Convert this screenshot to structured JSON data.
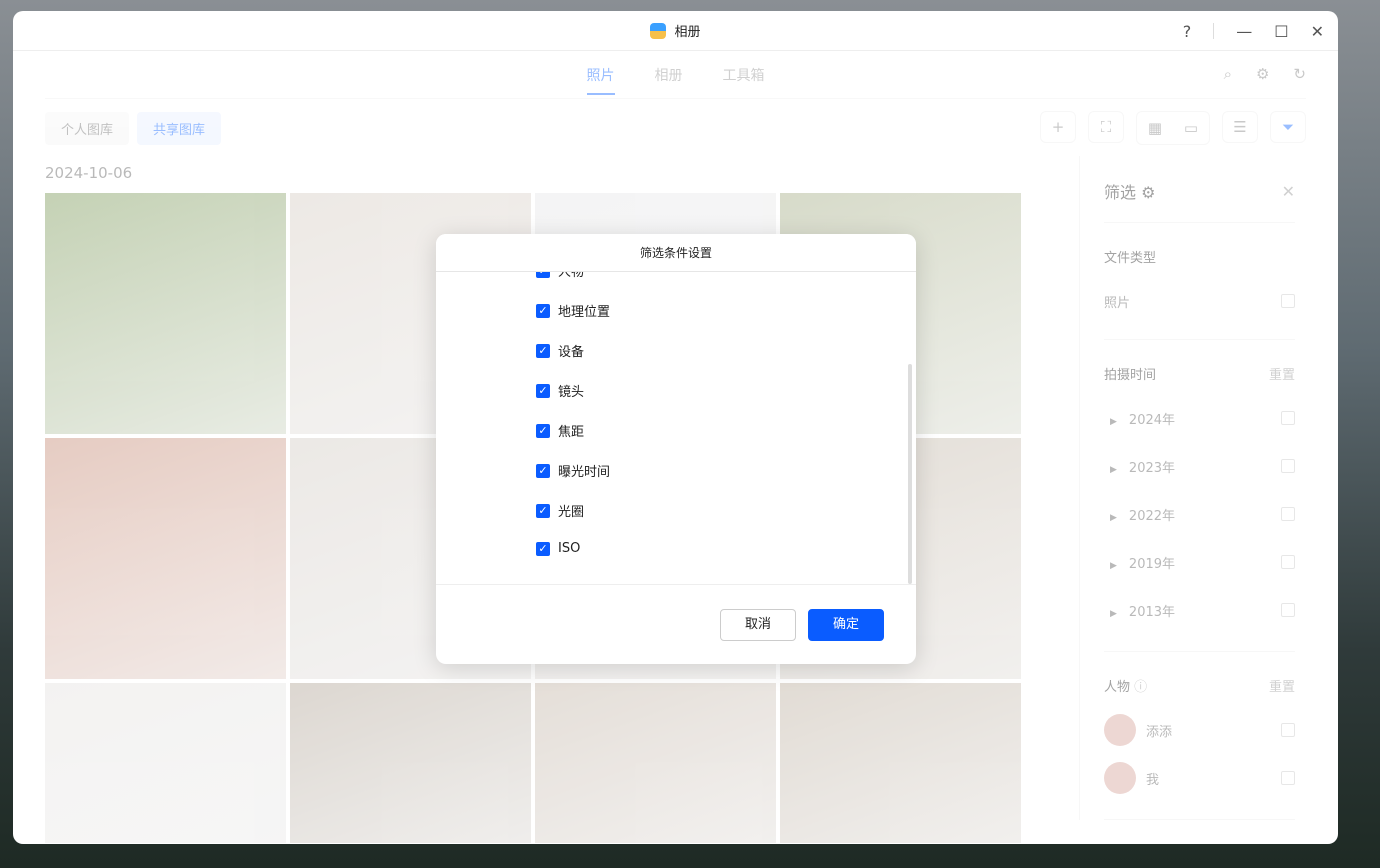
{
  "window": {
    "title": "相册",
    "help": "?",
    "minimize": "—",
    "maximize": "☐",
    "close": "✕"
  },
  "tabs": [
    {
      "label": "照片"
    },
    {
      "label": "相册"
    },
    {
      "label": "工具箱"
    }
  ],
  "library": {
    "personal": "个人图库",
    "shared": "共享图库"
  },
  "date": "2024-10-06",
  "photo_colors": [
    "#7d9a5a",
    "#d8cfc6",
    "#e8e8ea",
    "#a8b08a",
    "#c98f7a",
    "#d6cfc8",
    "#d8d0c8",
    "#c4b8a8",
    "#e6e4e2",
    "#b4a89a",
    "#c6b8aa",
    "#bfb2a2"
  ],
  "sidebar": {
    "title": "筛选",
    "file_type": {
      "heading": "文件类型",
      "items": [
        "照片"
      ]
    },
    "time": {
      "heading": "拍摄时间",
      "reset": "重置",
      "years": [
        "2024年",
        "2023年",
        "2022年",
        "2019年",
        "2013年"
      ]
    },
    "people": {
      "heading": "人物",
      "reset": "重置",
      "persons": [
        "添添",
        "我"
      ]
    }
  },
  "dialog": {
    "title": "筛选条件设置",
    "items": [
      "人物",
      "地理位置",
      "设备",
      "镜头",
      "焦距",
      "曝光时间",
      "光圈",
      "ISO"
    ],
    "cancel": "取消",
    "ok": "确定"
  }
}
